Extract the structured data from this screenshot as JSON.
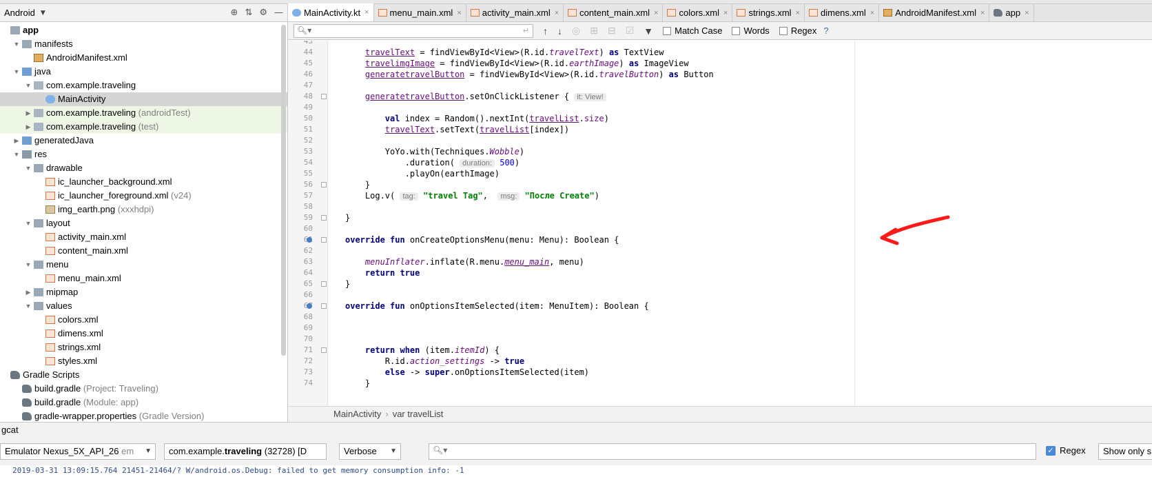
{
  "project": {
    "view_label": "Android",
    "tree": [
      {
        "label": "app",
        "bold": true,
        "arrow": "",
        "indent": 0,
        "icon": "folder",
        "hint": ""
      },
      {
        "label": "manifests",
        "arrow": "▼",
        "indent": 1,
        "icon": "folder",
        "hint": ""
      },
      {
        "label": "AndroidManifest.xml",
        "arrow": "",
        "indent": 2,
        "icon": "manifest",
        "hint": ""
      },
      {
        "label": "java",
        "arrow": "▼",
        "indent": 1,
        "icon": "folder-src",
        "hint": ""
      },
      {
        "label": "com.example.traveling",
        "arrow": "▼",
        "indent": 2,
        "icon": "folder-pkg",
        "hint": ""
      },
      {
        "label": "MainActivity",
        "arrow": "",
        "indent": 3,
        "icon": "kotlin",
        "hint": "",
        "selected": true
      },
      {
        "label": "com.example.traveling",
        "arrow": "▶",
        "indent": 2,
        "icon": "folder-pkg",
        "hint": "(androidTest)",
        "test": true
      },
      {
        "label": "com.example.traveling",
        "arrow": "▶",
        "indent": 2,
        "icon": "folder-pkg",
        "hint": "(test)",
        "test": true
      },
      {
        "label": "generatedJava",
        "arrow": "▶",
        "indent": 1,
        "icon": "folder-src",
        "hint": ""
      },
      {
        "label": "res",
        "arrow": "▼",
        "indent": 1,
        "icon": "folder-res",
        "hint": ""
      },
      {
        "label": "drawable",
        "arrow": "▼",
        "indent": 2,
        "icon": "folder",
        "hint": ""
      },
      {
        "label": "ic_launcher_background.xml",
        "arrow": "",
        "indent": 3,
        "icon": "xml",
        "hint": ""
      },
      {
        "label": "ic_launcher_foreground.xml",
        "arrow": "",
        "indent": 3,
        "icon": "xml",
        "hint": "(v24)"
      },
      {
        "label": "img_earth.png",
        "arrow": "",
        "indent": 3,
        "icon": "png",
        "hint": "(xxxhdpi)"
      },
      {
        "label": "layout",
        "arrow": "▼",
        "indent": 2,
        "icon": "folder",
        "hint": ""
      },
      {
        "label": "activity_main.xml",
        "arrow": "",
        "indent": 3,
        "icon": "xml",
        "hint": ""
      },
      {
        "label": "content_main.xml",
        "arrow": "",
        "indent": 3,
        "icon": "xml",
        "hint": ""
      },
      {
        "label": "menu",
        "arrow": "▼",
        "indent": 2,
        "icon": "folder",
        "hint": ""
      },
      {
        "label": "menu_main.xml",
        "arrow": "",
        "indent": 3,
        "icon": "xml",
        "hint": ""
      },
      {
        "label": "mipmap",
        "arrow": "▶",
        "indent": 2,
        "icon": "folder",
        "hint": ""
      },
      {
        "label": "values",
        "arrow": "▼",
        "indent": 2,
        "icon": "folder",
        "hint": ""
      },
      {
        "label": "colors.xml",
        "arrow": "",
        "indent": 3,
        "icon": "xml",
        "hint": ""
      },
      {
        "label": "dimens.xml",
        "arrow": "",
        "indent": 3,
        "icon": "xml",
        "hint": ""
      },
      {
        "label": "strings.xml",
        "arrow": "",
        "indent": 3,
        "icon": "xml",
        "hint": ""
      },
      {
        "label": "styles.xml",
        "arrow": "",
        "indent": 3,
        "icon": "xml",
        "hint": ""
      },
      {
        "label": "Gradle Scripts",
        "arrow": "",
        "indent": 0,
        "icon": "gradle",
        "hint": ""
      },
      {
        "label": "build.gradle",
        "arrow": "",
        "indent": 1,
        "icon": "gradle",
        "hint": "(Project: Traveling)"
      },
      {
        "label": "build.gradle",
        "arrow": "",
        "indent": 1,
        "icon": "gradle",
        "hint": "(Module: app)"
      },
      {
        "label": "gradle-wrapper.properties",
        "arrow": "",
        "indent": 1,
        "icon": "gradle",
        "hint": "(Gradle Version)"
      }
    ]
  },
  "tabs": [
    {
      "label": "MainActivity.kt",
      "icon": "kotlin",
      "active": true
    },
    {
      "label": "menu_main.xml",
      "icon": "xml"
    },
    {
      "label": "activity_main.xml",
      "icon": "xml"
    },
    {
      "label": "content_main.xml",
      "icon": "xml"
    },
    {
      "label": "colors.xml",
      "icon": "xml"
    },
    {
      "label": "strings.xml",
      "icon": "xml"
    },
    {
      "label": "dimens.xml",
      "icon": "xml"
    },
    {
      "label": "AndroidManifest.xml",
      "icon": "manifest"
    },
    {
      "label": "app",
      "icon": "gradle"
    }
  ],
  "tab_close_glyph": "×",
  "find": {
    "match_case": "Match Case",
    "words": "Words",
    "regex": "Regex",
    "help": "?"
  },
  "code_lines": [
    {
      "n": "43",
      "html": ""
    },
    {
      "n": "44",
      "html": "    <span class=\"field\">travelText</span> = findViewById&lt;View&gt;(R.id.<span class=\"ital\">travelText</span>) <span class=\"kw\">as</span> TextView"
    },
    {
      "n": "45",
      "html": "    <span class=\"field\">travelimgImage</span> = findViewById&lt;View&gt;(R.id.<span class=\"ital\">earthImage</span>) <span class=\"kw\">as</span> ImageView"
    },
    {
      "n": "46",
      "html": "    <span class=\"field\">generatetravelButton</span> = findViewById&lt;View&gt;(R.id.<span class=\"ital\">travelButton</span>) <span class=\"kw\">as</span> Button"
    },
    {
      "n": "47",
      "html": ""
    },
    {
      "n": "48",
      "html": "    <span class=\"field\">generatetravelButton</span>.setOnClickListener { <span class=\"inlay\">it: View!</span>",
      "fold": true
    },
    {
      "n": "49",
      "html": ""
    },
    {
      "n": "50",
      "html": "        <span class=\"kw\">val</span> index = Random().nextInt(<span class=\"field\">travelList</span>.<span style=\"color:#660e7a\">size</span>)"
    },
    {
      "n": "51",
      "html": "        <span class=\"field\">travelText</span>.setText(<span class=\"field\">travelList</span>[index])"
    },
    {
      "n": "52",
      "html": ""
    },
    {
      "n": "53",
      "html": "        YoYo.with(Techniques.<span class=\"ital\">Wobble</span>)"
    },
    {
      "n": "54",
      "html": "            .duration( <span class=\"inlay\">duration:</span> <span class=\"num-lit\">500</span>)"
    },
    {
      "n": "55",
      "html": "            .playOn(earthImage)"
    },
    {
      "n": "56",
      "html": "    }",
      "fold": true
    },
    {
      "n": "57",
      "html": "    Log.v( <span class=\"inlay\">tag:</span> <span class=\"str\">\"travel Tag\"</span>,  <span class=\"inlay\">msg:</span> <span class=\"str\">\"После Create\"</span>)"
    },
    {
      "n": "58",
      "html": ""
    },
    {
      "n": "59",
      "html": "}",
      "fold": true
    },
    {
      "n": "60",
      "html": ""
    },
    {
      "n": "61",
      "html": "<span class=\"kw\">override fun</span> onCreateOptionsMenu(menu: Menu): Boolean {",
      "fold": true,
      "gicon": true
    },
    {
      "n": "62",
      "html": ""
    },
    {
      "n": "63",
      "html": "    <span class=\"ital\" style=\"text-decoration:none\">menuInflater</span>.inflate(R.menu.<span class=\"ital\" style=\"text-decoration:underline\">menu_main</span>, menu)"
    },
    {
      "n": "64",
      "html": "    <span class=\"kw\">return true</span>"
    },
    {
      "n": "65",
      "html": "}",
      "fold": true
    },
    {
      "n": "66",
      "html": ""
    },
    {
      "n": "67",
      "html": "<span class=\"kw\">override fun</span> onOptionsItemSelected(item: MenuItem): Boolean {",
      "fold": true,
      "gicon": true
    },
    {
      "n": "68",
      "html": ""
    },
    {
      "n": "69",
      "html": ""
    },
    {
      "n": "70",
      "html": ""
    },
    {
      "n": "71",
      "html": "    <span class=\"kw\">return when</span> (item.<span class=\"ital\">itemId</span>) {",
      "fold": true
    },
    {
      "n": "72",
      "html": "        R.id.<span class=\"ital\">action_settings</span> -&gt; <span class=\"kw\">true</span>"
    },
    {
      "n": "73",
      "html": "        <span class=\"kw\">else</span> -&gt; <span class=\"kw\">super</span>.onOptionsItemSelected(item)"
    },
    {
      "n": "74",
      "html": "    }"
    }
  ],
  "breadcrumb": {
    "class_name": "MainActivity",
    "member": "var travelList"
  },
  "logcat": {
    "title": "gcat",
    "device": "Emulator Nexus_5X_API_26",
    "device_suffix": "em",
    "process_prefix": "com.example.",
    "process_bold": "traveling",
    "process_suffix": "(32728) [D",
    "level": "Verbose",
    "regex_label": "Regex",
    "regex_checked": true,
    "show_only": "Show only s",
    "log_line": "2019-03-31 13:09:15.764 21451-21464/? W/android.os.Debug: failed to get memory consumption info: -1"
  },
  "colors": {
    "arrow_annotation": "#ff1a1a",
    "keyword": "#000080",
    "string": "#008000"
  }
}
